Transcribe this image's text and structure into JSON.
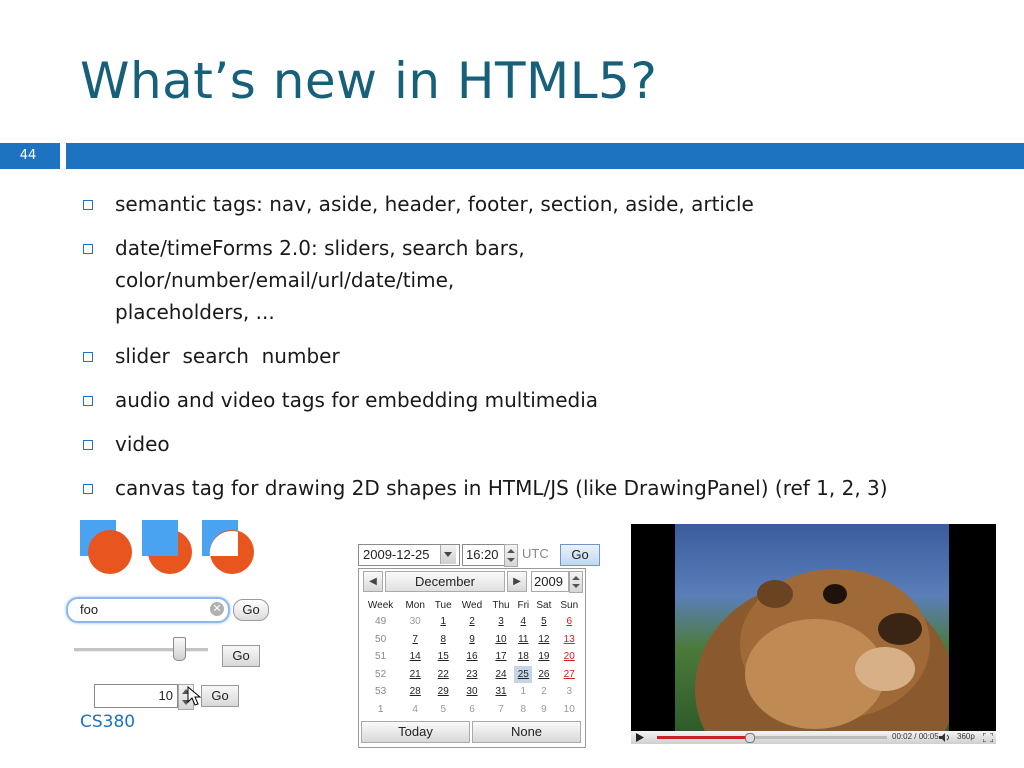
{
  "slide": {
    "title": "What’s new in HTML5?",
    "number": "44",
    "footer": "CS380"
  },
  "bullets": [
    "semantic tags: nav, aside, header, footer, section, aside, article",
    "date/timeForms 2.0: sliders, search bars, color/number/email/url/date/time, placeholders, ...",
    "slider  search  number",
    "audio and video tags for embedding multimedia",
    "video",
    "canvas tag for drawing 2D shapes in HTML/JS (like DrawingPanel) (ref 1, 2, 3)"
  ],
  "colors": {
    "title": "#17607a",
    "accent_bar": "#1e73c0",
    "square": "#4aa3f0",
    "circle": "#e8551e"
  },
  "search_demo": {
    "value": "foo",
    "go_label": "Go"
  },
  "slider_demo": {
    "go_label": "Go",
    "level_fraction": 0.78
  },
  "number_demo": {
    "value": "10",
    "go_label": "Go"
  },
  "date_picker": {
    "date_value": "2009-12-25",
    "time_value": "16:20",
    "timezone": "UTC",
    "go_label": "Go",
    "month": "December",
    "year": "2009",
    "headers": [
      "Week",
      "Mon",
      "Tue",
      "Wed",
      "Thu",
      "Fri",
      "Sat",
      "Sun"
    ],
    "weeks": [
      [
        "49",
        "30",
        "1",
        "2",
        "3",
        "4",
        "5",
        "6"
      ],
      [
        "50",
        "7",
        "8",
        "9",
        "10",
        "11",
        "12",
        "13"
      ],
      [
        "51",
        "14",
        "15",
        "16",
        "17",
        "18",
        "19",
        "20"
      ],
      [
        "52",
        "21",
        "22",
        "23",
        "24",
        "25",
        "26",
        "27"
      ],
      [
        "53",
        "28",
        "29",
        "30",
        "31",
        "1",
        "2",
        "3"
      ],
      [
        "1",
        "4",
        "5",
        "6",
        "7",
        "8",
        "9",
        "10"
      ]
    ],
    "today_label": "Today",
    "none_label": "None"
  },
  "video_player": {
    "time": "00:02 / 00:05",
    "quality": "360p",
    "progress_fraction": 0.4
  }
}
